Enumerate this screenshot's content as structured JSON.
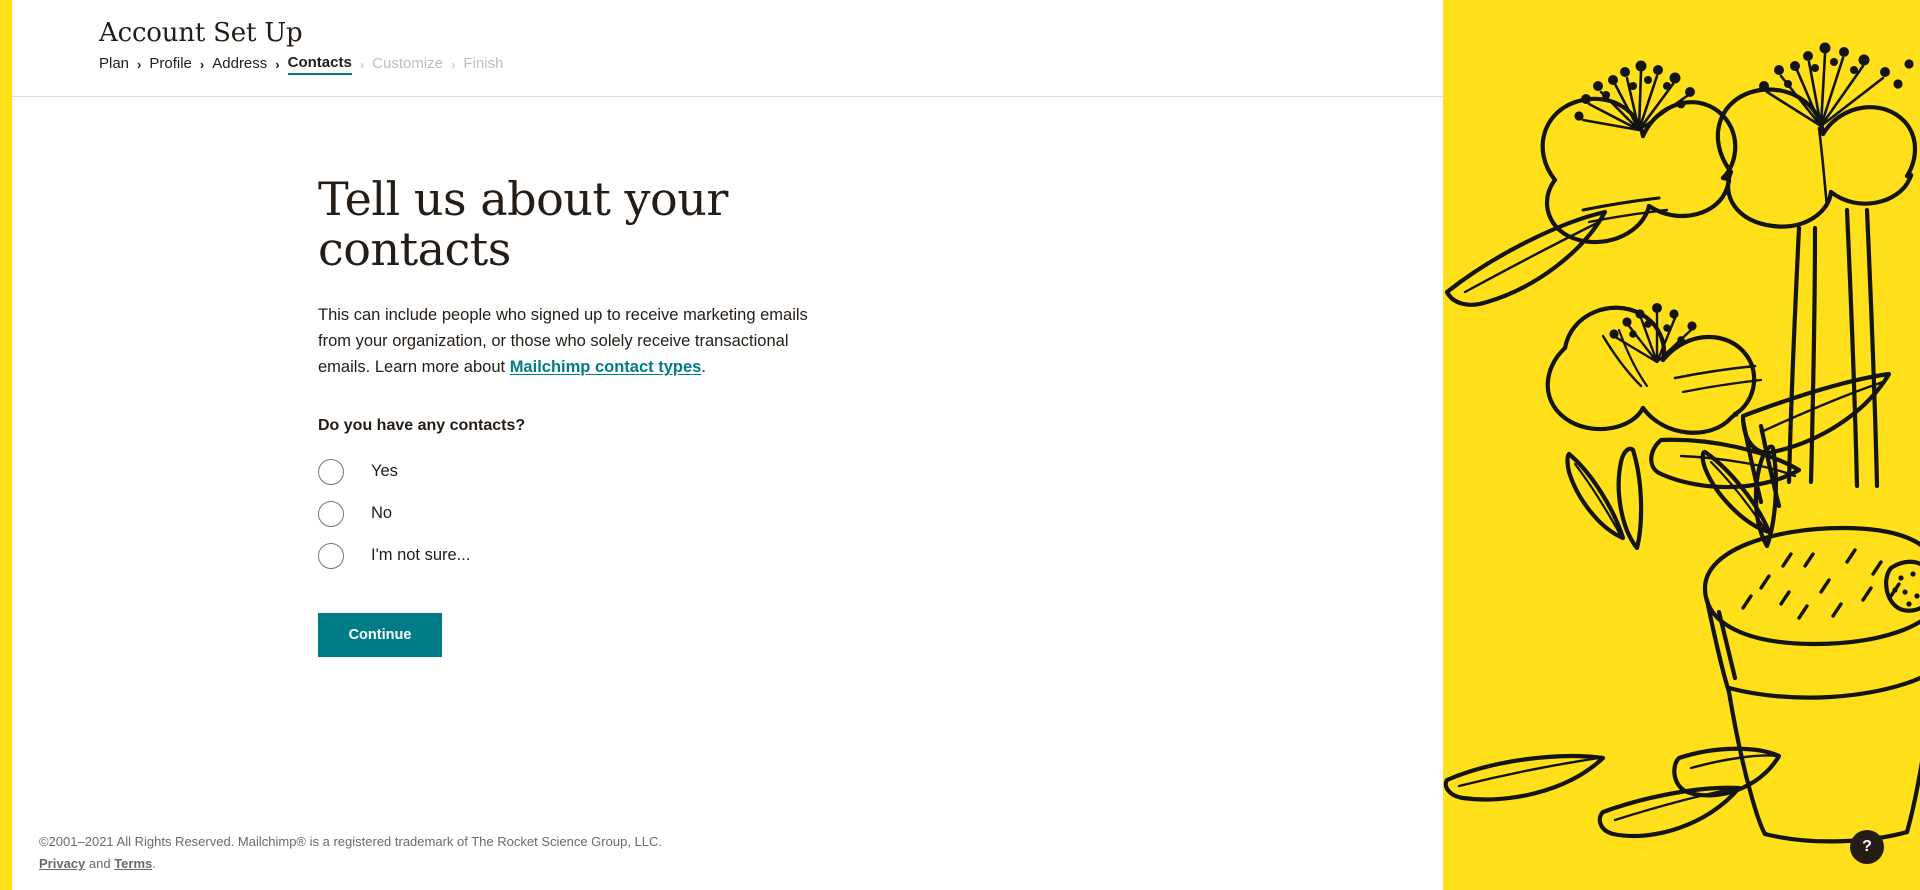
{
  "colors": {
    "brand_yellow": "#ffe01b",
    "brand_teal": "#007c89",
    "ink": "#241c15",
    "muted": "#bfbfbf"
  },
  "header": {
    "title": "Account Set Up",
    "breadcrumb": [
      {
        "label": "Plan",
        "state": "done"
      },
      {
        "label": "Profile",
        "state": "done"
      },
      {
        "label": "Address",
        "state": "done"
      },
      {
        "label": "Contacts",
        "state": "current"
      },
      {
        "label": "Customize",
        "state": "disabled"
      },
      {
        "label": "Finish",
        "state": "disabled"
      }
    ],
    "separator": "›"
  },
  "main": {
    "heading": "Tell us about your contacts",
    "description_part1": "This can include people who signed up to receive marketing emails from your organization, or those who solely receive transactional emails. Learn more about ",
    "description_link": "Mailchimp contact types",
    "description_part2": ".",
    "question": "Do you have any contacts?",
    "options": [
      {
        "label": "Yes",
        "value": "yes",
        "selected": false
      },
      {
        "label": "No",
        "value": "no",
        "selected": false
      },
      {
        "label": "I'm not sure...",
        "value": "not-sure",
        "selected": false
      }
    ],
    "continue_label": "Continue"
  },
  "footer": {
    "copyright": "©2001–2021 All Rights Reserved. Mailchimp® is a registered trademark of The Rocket Science Group, LLC.",
    "privacy_label": "Privacy",
    "and_label": " and ",
    "terms_label": "Terms",
    "period": "."
  },
  "help": {
    "label": "?"
  },
  "illustration": {
    "name": "potted-flowering-plant-line-drawing",
    "background": "#ffe01b",
    "stroke": "#000000"
  }
}
